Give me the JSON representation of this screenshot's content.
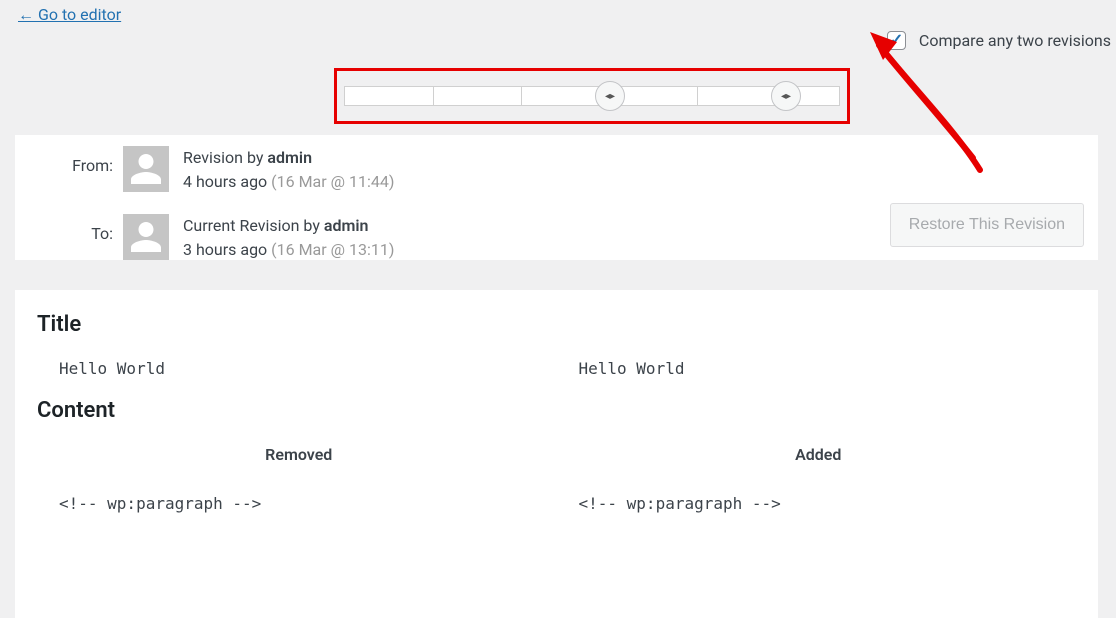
{
  "back_link_label": "← Go to editor",
  "compare_checkbox": {
    "label": "Compare any two revisions",
    "checked": true
  },
  "meta": {
    "from_label": "From:",
    "to_label": "To:",
    "from": {
      "prefix": "Revision by ",
      "author": "admin",
      "time": "4 hours ago",
      "stamp": "(16 Mar @ 11:44)"
    },
    "to": {
      "prefix": "Current Revision by ",
      "author": "admin",
      "time": "3 hours ago",
      "stamp": "(16 Mar @ 13:11)"
    },
    "restore_label": "Restore This Revision"
  },
  "diff": {
    "title_heading": "Title",
    "content_heading": "Content",
    "title_left": "Hello World",
    "title_right": "Hello World",
    "removed_label": "Removed",
    "added_label": "Added",
    "code_left": "<!-- wp:paragraph -->",
    "code_right": "<!-- wp:paragraph -->"
  }
}
